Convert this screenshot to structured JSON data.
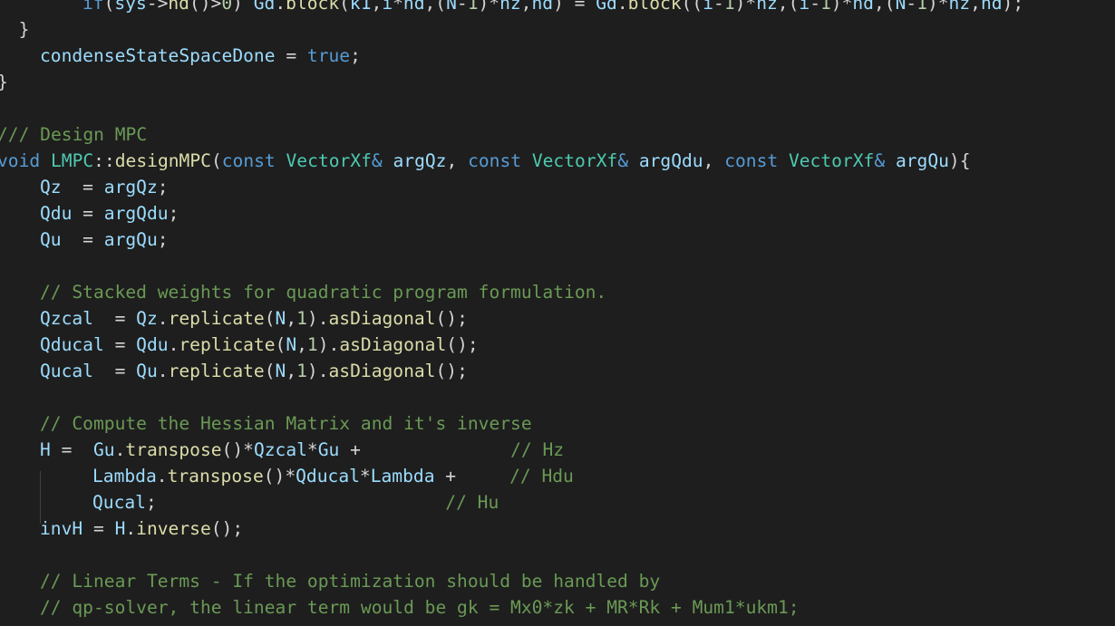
{
  "colors": {
    "background": "#1e1e1e",
    "keyword": "#569cd6",
    "type": "#4ec9b0",
    "function": "#dcdcaa",
    "variable": "#9cdcfe",
    "number": "#b5cea8",
    "comment": "#6a9955",
    "text": "#d4d4d4"
  },
  "lines": [
    {
      "tokens": [
        {
          "t": "    ",
          "c": "txt"
        },
        {
          "t": "if",
          "c": "kw"
        },
        {
          "t": "(",
          "c": "txt"
        },
        {
          "t": "sys",
          "c": "var"
        },
        {
          "t": "->",
          "c": "txt"
        },
        {
          "t": "nd",
          "c": "fn"
        },
        {
          "t": "()>",
          "c": "txt"
        },
        {
          "t": "0",
          "c": "num"
        },
        {
          "t": ") ",
          "c": "txt"
        },
        {
          "t": "Gd",
          "c": "var"
        },
        {
          "t": ".",
          "c": "txt"
        },
        {
          "t": "block",
          "c": "fn"
        },
        {
          "t": "(",
          "c": "txt"
        },
        {
          "t": "k1",
          "c": "var"
        },
        {
          "t": ",",
          "c": "txt"
        },
        {
          "t": "i",
          "c": "var"
        },
        {
          "t": "*",
          "c": "txt"
        },
        {
          "t": "nd",
          "c": "var"
        },
        {
          "t": ",(",
          "c": "txt"
        },
        {
          "t": "N",
          "c": "var"
        },
        {
          "t": "-",
          "c": "txt"
        },
        {
          "t": "1",
          "c": "num"
        },
        {
          "t": ")*",
          "c": "txt"
        },
        {
          "t": "nz",
          "c": "var"
        },
        {
          "t": ",",
          "c": "txt"
        },
        {
          "t": "nd",
          "c": "var"
        },
        {
          "t": ") = ",
          "c": "txt"
        },
        {
          "t": "Gd",
          "c": "var"
        },
        {
          "t": ".",
          "c": "txt"
        },
        {
          "t": "block",
          "c": "fn"
        },
        {
          "t": "((",
          "c": "txt"
        },
        {
          "t": "i",
          "c": "var"
        },
        {
          "t": "-",
          "c": "txt"
        },
        {
          "t": "1",
          "c": "num"
        },
        {
          "t": ")*",
          "c": "txt"
        },
        {
          "t": "nz",
          "c": "var"
        },
        {
          "t": ",(",
          "c": "txt"
        },
        {
          "t": "i",
          "c": "var"
        },
        {
          "t": "-",
          "c": "txt"
        },
        {
          "t": "1",
          "c": "num"
        },
        {
          "t": ")*",
          "c": "txt"
        },
        {
          "t": "nd",
          "c": "var"
        },
        {
          "t": ",(",
          "c": "txt"
        },
        {
          "t": "N",
          "c": "var"
        },
        {
          "t": "-",
          "c": "txt"
        },
        {
          "t": "1",
          "c": "num"
        },
        {
          "t": ")*",
          "c": "txt"
        },
        {
          "t": "nz",
          "c": "var"
        },
        {
          "t": ",",
          "c": "txt"
        },
        {
          "t": "nd",
          "c": "var"
        },
        {
          "t": ");",
          "c": "txt"
        }
      ]
    },
    {
      "tokens": [
        {
          "t": "  }",
          "c": "txt"
        }
      ]
    },
    {
      "tokens": [
        {
          "t": "  ",
          "c": "txt"
        },
        {
          "t": "condenseStateSpaceDone",
          "c": "var"
        },
        {
          "t": " = ",
          "c": "txt"
        },
        {
          "t": "true",
          "c": "kw"
        },
        {
          "t": ";",
          "c": "txt"
        }
      ]
    },
    {
      "tokens": [
        {
          "t": "}",
          "c": "txt"
        }
      ]
    },
    {
      "tokens": []
    },
    {
      "tokens": [
        {
          "t": "/// Design MPC",
          "c": "com"
        }
      ]
    },
    {
      "tokens": [
        {
          "t": "void",
          "c": "kw"
        },
        {
          "t": " ",
          "c": "txt"
        },
        {
          "t": "LMPC",
          "c": "ty"
        },
        {
          "t": "::",
          "c": "txt"
        },
        {
          "t": "designMPC",
          "c": "fn"
        },
        {
          "t": "(",
          "c": "txt"
        },
        {
          "t": "const",
          "c": "kw"
        },
        {
          "t": " ",
          "c": "txt"
        },
        {
          "t": "VectorXf",
          "c": "ty"
        },
        {
          "t": "&",
          "c": "kw"
        },
        {
          "t": " ",
          "c": "txt"
        },
        {
          "t": "argQz",
          "c": "var"
        },
        {
          "t": ", ",
          "c": "txt"
        },
        {
          "t": "const",
          "c": "kw"
        },
        {
          "t": " ",
          "c": "txt"
        },
        {
          "t": "VectorXf",
          "c": "ty"
        },
        {
          "t": "&",
          "c": "kw"
        },
        {
          "t": " ",
          "c": "txt"
        },
        {
          "t": "argQdu",
          "c": "var"
        },
        {
          "t": ", ",
          "c": "txt"
        },
        {
          "t": "const",
          "c": "kw"
        },
        {
          "t": " ",
          "c": "txt"
        },
        {
          "t": "VectorXf",
          "c": "ty"
        },
        {
          "t": "&",
          "c": "kw"
        },
        {
          "t": " ",
          "c": "txt"
        },
        {
          "t": "argQu",
          "c": "var"
        },
        {
          "t": "){",
          "c": "txt"
        }
      ]
    },
    {
      "tokens": [
        {
          "t": "  ",
          "c": "txt"
        },
        {
          "t": "Qz",
          "c": "var"
        },
        {
          "t": "  = ",
          "c": "txt"
        },
        {
          "t": "argQz",
          "c": "var"
        },
        {
          "t": ";",
          "c": "txt"
        }
      ]
    },
    {
      "tokens": [
        {
          "t": "  ",
          "c": "txt"
        },
        {
          "t": "Qdu",
          "c": "var"
        },
        {
          "t": " = ",
          "c": "txt"
        },
        {
          "t": "argQdu",
          "c": "var"
        },
        {
          "t": ";",
          "c": "txt"
        }
      ]
    },
    {
      "tokens": [
        {
          "t": "  ",
          "c": "txt"
        },
        {
          "t": "Qu",
          "c": "var"
        },
        {
          "t": "  = ",
          "c": "txt"
        },
        {
          "t": "argQu",
          "c": "var"
        },
        {
          "t": ";",
          "c": "txt"
        }
      ]
    },
    {
      "tokens": []
    },
    {
      "tokens": [
        {
          "t": "  ",
          "c": "txt"
        },
        {
          "t": "// Stacked weights for quadratic program formulation.",
          "c": "com"
        }
      ]
    },
    {
      "tokens": [
        {
          "t": "  ",
          "c": "txt"
        },
        {
          "t": "Qzcal",
          "c": "var"
        },
        {
          "t": "  = ",
          "c": "txt"
        },
        {
          "t": "Qz",
          "c": "var"
        },
        {
          "t": ".",
          "c": "txt"
        },
        {
          "t": "replicate",
          "c": "fn"
        },
        {
          "t": "(",
          "c": "txt"
        },
        {
          "t": "N",
          "c": "var"
        },
        {
          "t": ",",
          "c": "txt"
        },
        {
          "t": "1",
          "c": "num"
        },
        {
          "t": ").",
          "c": "txt"
        },
        {
          "t": "asDiagonal",
          "c": "fn"
        },
        {
          "t": "();",
          "c": "txt"
        }
      ]
    },
    {
      "tokens": [
        {
          "t": "  ",
          "c": "txt"
        },
        {
          "t": "Qducal",
          "c": "var"
        },
        {
          "t": " = ",
          "c": "txt"
        },
        {
          "t": "Qdu",
          "c": "var"
        },
        {
          "t": ".",
          "c": "txt"
        },
        {
          "t": "replicate",
          "c": "fn"
        },
        {
          "t": "(",
          "c": "txt"
        },
        {
          "t": "N",
          "c": "var"
        },
        {
          "t": ",",
          "c": "txt"
        },
        {
          "t": "1",
          "c": "num"
        },
        {
          "t": ").",
          "c": "txt"
        },
        {
          "t": "asDiagonal",
          "c": "fn"
        },
        {
          "t": "();",
          "c": "txt"
        }
      ]
    },
    {
      "tokens": [
        {
          "t": "  ",
          "c": "txt"
        },
        {
          "t": "Qucal",
          "c": "var"
        },
        {
          "t": "  = ",
          "c": "txt"
        },
        {
          "t": "Qu",
          "c": "var"
        },
        {
          "t": ".",
          "c": "txt"
        },
        {
          "t": "replicate",
          "c": "fn"
        },
        {
          "t": "(",
          "c": "txt"
        },
        {
          "t": "N",
          "c": "var"
        },
        {
          "t": ",",
          "c": "txt"
        },
        {
          "t": "1",
          "c": "num"
        },
        {
          "t": ").",
          "c": "txt"
        },
        {
          "t": "asDiagonal",
          "c": "fn"
        },
        {
          "t": "();",
          "c": "txt"
        }
      ]
    },
    {
      "tokens": []
    },
    {
      "tokens": [
        {
          "t": "  ",
          "c": "txt"
        },
        {
          "t": "// Compute the Hessian Matrix and it's inverse",
          "c": "com"
        }
      ]
    },
    {
      "tokens": [
        {
          "t": "  ",
          "c": "txt"
        },
        {
          "t": "H",
          "c": "var"
        },
        {
          "t": " =  ",
          "c": "txt"
        },
        {
          "t": "Gu",
          "c": "var"
        },
        {
          "t": ".",
          "c": "txt"
        },
        {
          "t": "transpose",
          "c": "fn"
        },
        {
          "t": "()*",
          "c": "txt"
        },
        {
          "t": "Qzcal",
          "c": "var"
        },
        {
          "t": "*",
          "c": "txt"
        },
        {
          "t": "Gu",
          "c": "var"
        },
        {
          "t": " +              ",
          "c": "txt"
        },
        {
          "t": "// Hz",
          "c": "com"
        }
      ]
    },
    {
      "tokens": [
        {
          "t": "       ",
          "c": "txt"
        },
        {
          "t": "Lambda",
          "c": "var"
        },
        {
          "t": ".",
          "c": "txt"
        },
        {
          "t": "transpose",
          "c": "fn"
        },
        {
          "t": "()*",
          "c": "txt"
        },
        {
          "t": "Qducal",
          "c": "var"
        },
        {
          "t": "*",
          "c": "txt"
        },
        {
          "t": "Lambda",
          "c": "var"
        },
        {
          "t": " +     ",
          "c": "txt"
        },
        {
          "t": "// Hdu",
          "c": "com"
        }
      ]
    },
    {
      "tokens": [
        {
          "t": "       ",
          "c": "txt"
        },
        {
          "t": "Qucal",
          "c": "var"
        },
        {
          "t": ";                           ",
          "c": "txt"
        },
        {
          "t": "// Hu",
          "c": "com"
        }
      ]
    },
    {
      "tokens": [
        {
          "t": "  ",
          "c": "txt"
        },
        {
          "t": "invH",
          "c": "var"
        },
        {
          "t": " = ",
          "c": "txt"
        },
        {
          "t": "H",
          "c": "var"
        },
        {
          "t": ".",
          "c": "txt"
        },
        {
          "t": "inverse",
          "c": "fn"
        },
        {
          "t": "();",
          "c": "txt"
        }
      ]
    },
    {
      "tokens": []
    },
    {
      "tokens": [
        {
          "t": "  ",
          "c": "txt"
        },
        {
          "t": "// Linear Terms - If the optimization should be handled by",
          "c": "com"
        }
      ]
    },
    {
      "tokens": [
        {
          "t": "  ",
          "c": "txt"
        },
        {
          "t": "// qp-solver, the linear term would be gk = Mx0*zk + MR*Rk + Mum1*ukm1;",
          "c": "com"
        }
      ]
    }
  ]
}
